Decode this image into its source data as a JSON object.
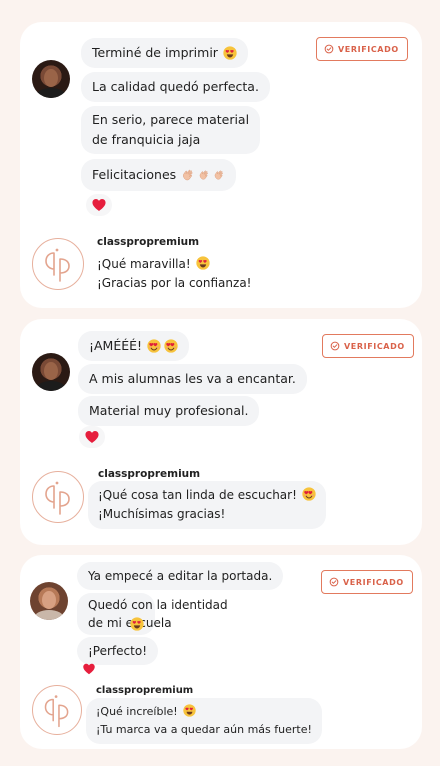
{
  "badge_label": "VERIFICADO",
  "brand_name": "classpropremium",
  "colors": {
    "accent": "#e27a5e",
    "bubble": "#f3f4f6",
    "background": "#fbf3ef",
    "card": "#ffffff"
  },
  "cards": [
    {
      "messages": [
        {
          "text": "Terminé de imprimir",
          "emoji": "heart-eyes"
        },
        {
          "text": "La calidad quedó perfecta."
        },
        {
          "text": "En serio, parece material\nde franquicia jaja"
        },
        {
          "text": "Felicitaciones",
          "emoji": "clapping-hands-x3"
        }
      ],
      "reaction": "red-heart",
      "reply": [
        "¡Qué maravilla!",
        "¡Gracias por la confianza!"
      ]
    },
    {
      "messages": [
        {
          "text": "¡AMÉÉÉ!",
          "emoji": "heart-eyes-x2"
        },
        {
          "text": "A mis alumnas les va a encantar."
        },
        {
          "text": "Material muy profesional."
        }
      ],
      "reaction": "red-heart",
      "reply": [
        "¡Qué cosa tan linda de escuchar!",
        "¡Muchísimas gracias!"
      ]
    },
    {
      "messages": [
        {
          "text": "Ya empecé a editar la portada."
        },
        {
          "text": "Quedó con la identidad\nde mi escuela",
          "emoji": "heart-eyes"
        },
        {
          "text": "¡Perfecto!"
        }
      ],
      "reaction": "red-heart",
      "reply": [
        "¡Qué increíble!",
        "¡Tu marca va a quedar aún más fuerte!"
      ]
    }
  ]
}
